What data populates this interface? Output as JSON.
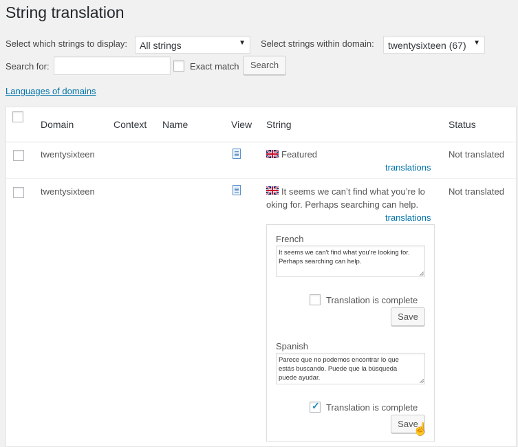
{
  "page": {
    "title": "String translation"
  },
  "filters": {
    "display_label": "Select which strings to display:",
    "display_value": "All strings",
    "domain_label": "Select strings within domain:",
    "domain_value": "twentysixteen (67)",
    "search_label": "Search for:",
    "search_value": "",
    "exact_label": "Exact match",
    "search_button": "Search",
    "languages_link": "Languages of domains"
  },
  "table": {
    "headers": {
      "domain": "Domain",
      "context": "Context",
      "name": "Name",
      "view": "View",
      "string": "String",
      "status": "Status"
    },
    "rows": [
      {
        "domain": "twentysixteen",
        "string_line1": "Featured",
        "translations_link": "translations",
        "status": "Not translated"
      },
      {
        "domain": "twentysixteen",
        "string_line1": "It seems we can’t find what you’re lo",
        "string_line2": "oking for. Perhaps searching can help.",
        "translations_link": "translations",
        "status": "Not translated"
      }
    ]
  },
  "translations": {
    "french": {
      "label": "French",
      "text_line1": "It seems we can't find what you're looking for.",
      "text_line2": "Perhaps searching can help.",
      "complete_label": "Translation is complete",
      "complete": false,
      "save": "Save"
    },
    "spanish": {
      "label": "Spanish",
      "text_line1": "Parece que no podemos encontrar lo que",
      "text_line2": "estás buscando. Puede que la búsqueda",
      "text_line3": "puede ayudar.",
      "complete_label": "Translation is complete",
      "complete": true,
      "save": "Save"
    }
  },
  "colors": {
    "link": "#0073aa",
    "background": "#f1f1f1",
    "checkmark": "#1e8cbe"
  },
  "icons": [
    "uk-flag-icon",
    "document-icon",
    "dropdown-arrow-icon",
    "hand-cursor-icon",
    "checkmark-icon"
  ]
}
